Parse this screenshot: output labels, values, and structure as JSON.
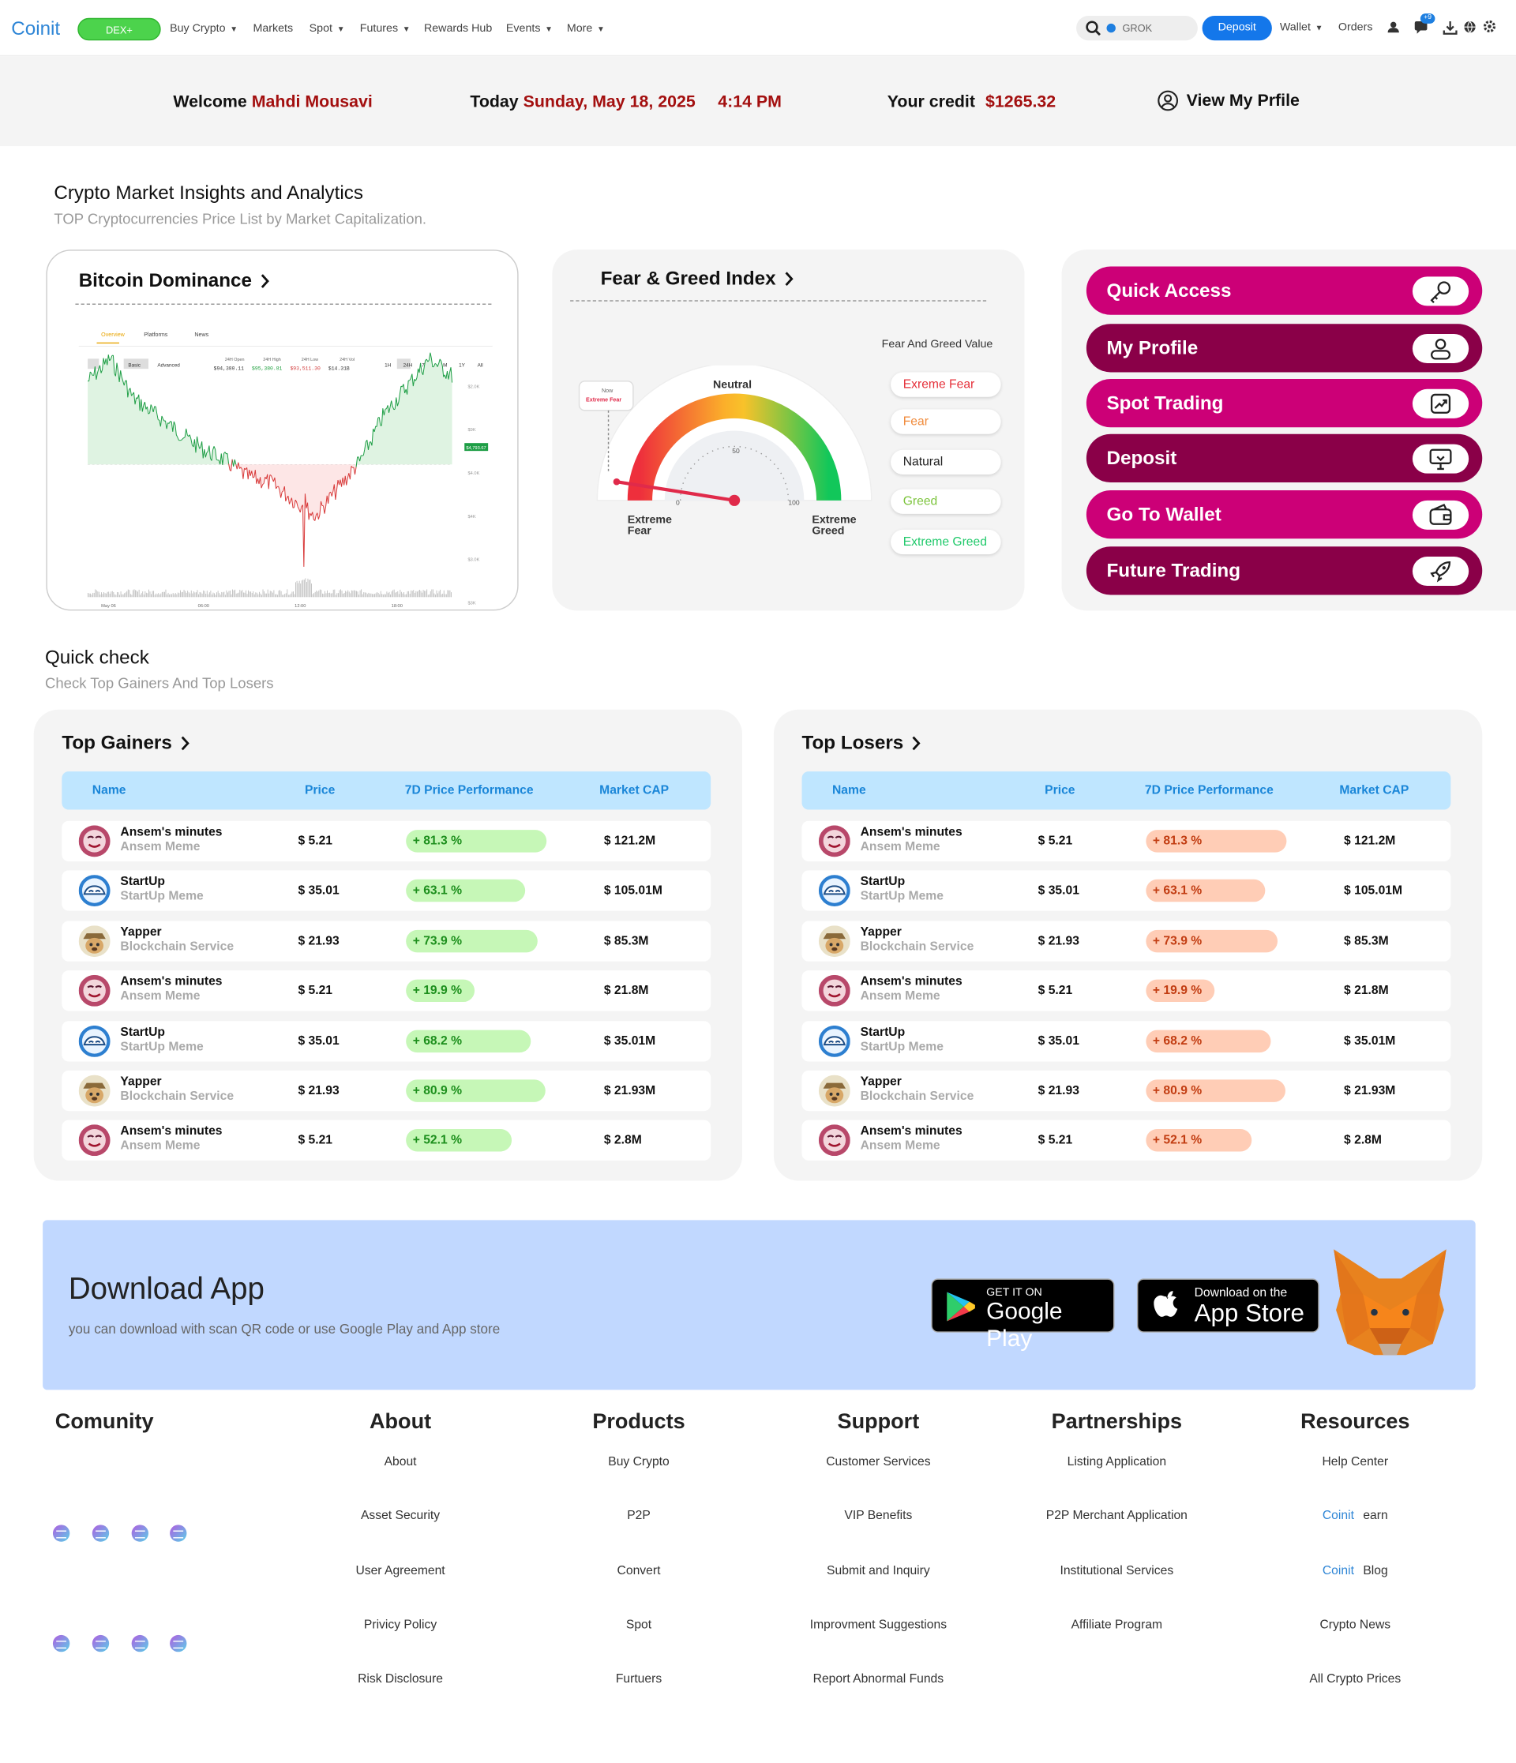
{
  "nav": {
    "logo": "Coinit",
    "dex": "DEX+",
    "items": [
      {
        "label": "Buy Crypto",
        "caret": true
      },
      {
        "label": "Markets",
        "caret": false
      },
      {
        "label": "Spot",
        "caret": true
      },
      {
        "label": "Futures",
        "caret": true
      },
      {
        "label": "Rewards Hub",
        "caret": false
      },
      {
        "label": "Events",
        "caret": true
      },
      {
        "label": "More",
        "caret": true
      }
    ],
    "search_text": "GROK",
    "deposit": "Deposit",
    "wallet": "Wallet",
    "orders": "Orders",
    "notif_badge": "+9"
  },
  "welcome": {
    "label": "Welcome",
    "name": "Mahdi Mousavi",
    "today_label": "Today",
    "date": "Sunday, May 18, 2025",
    "time": "4:14 PM",
    "credit_label": "Your credit",
    "credit": "$1265.32",
    "profile": "View My Prfile"
  },
  "insights": {
    "title": "Crypto Market Insights and Analytics",
    "subtitle": "TOP Cryptocurrencies Price List by Market Capitalization."
  },
  "btc": {
    "title": "Bitcoin Dominance",
    "tabs": [
      "Overview",
      "Platforms",
      "News"
    ],
    "modes": [
      "Basic",
      "Advanced"
    ],
    "stats": [
      {
        "label": "24H Open",
        "value": "$94,380.11",
        "color": "#333"
      },
      {
        "label": "24H High",
        "value": "$95,380.81",
        "color": "#1a9e3a"
      },
      {
        "label": "24H Low",
        "value": "$93,511.30",
        "color": "#d23a3a"
      },
      {
        "label": "24H Vol",
        "value": "$14.31B",
        "color": "#333"
      }
    ],
    "ranges": [
      "1H",
      "24H",
      "7D",
      "1M",
      "1Y",
      "All"
    ],
    "price_tag": "$4,793.67",
    "yticks": [
      "$2.0K",
      "$9K",
      "$4.0K",
      "$4K",
      "$3.0K",
      "$3K"
    ],
    "xticks": [
      "May 06",
      "06:00",
      "12:00",
      "18:00"
    ]
  },
  "fear": {
    "title": "Fear & Greed Index",
    "legend_title": "Fear And Greed Value",
    "now_label": "Now",
    "now_value": "Extreme Fear",
    "neutral": "Neutral",
    "left_label": "Extreme Fear",
    "right_label": "Extreme Greed",
    "ticks": [
      "0",
      "50",
      "100"
    ],
    "value": 5,
    "levels": [
      {
        "label": "Exreme Fear",
        "color": "#e5303a"
      },
      {
        "label": "Fear",
        "color": "#f08a3a"
      },
      {
        "label": "Natural",
        "color": "#222222"
      },
      {
        "label": "Greed",
        "color": "#7cc43c"
      },
      {
        "label": "Extreme Greed",
        "color": "#1fc96a"
      }
    ]
  },
  "quick_access": [
    {
      "label": "Quick Access",
      "icon": "key-icon",
      "color": "#cc0077"
    },
    {
      "label": "My Profile",
      "icon": "user-icon",
      "color": "#8a0048"
    },
    {
      "label": "Spot Trading",
      "icon": "chart-up-icon",
      "color": "#cc0077"
    },
    {
      "label": "Deposit",
      "icon": "deposit-icon",
      "color": "#8a0048"
    },
    {
      "label": "Go To Wallet",
      "icon": "wallet-icon",
      "color": "#cc0077"
    },
    {
      "label": "Future Trading",
      "icon": "rocket-icon",
      "color": "#8a0048"
    }
  ],
  "quick_check": {
    "title": "Quick check",
    "subtitle": "Check Top Gainers And Top Losers"
  },
  "columns": [
    "Name",
    "Price",
    "7D Price Performance",
    "Market CAP"
  ],
  "gainers": {
    "title": "Top Gainers",
    "rows": [
      {
        "name": "Ansem's minutes",
        "sub": "Ansem Meme",
        "avatar": "mask",
        "price": "$ 5.21",
        "perf": "+ 81.3 %",
        "pct": 81.3,
        "cap": "$ 121.2M"
      },
      {
        "name": "StartUp",
        "sub": "StartUp Meme",
        "avatar": "cloud",
        "price": "$ 35.01",
        "perf": "+ 63.1 %",
        "pct": 63.1,
        "cap": "$ 105.01M"
      },
      {
        "name": "Yapper",
        "sub": "Blockchain Service",
        "avatar": "dog",
        "price": "$ 21.93",
        "perf": "+ 73.9 %",
        "pct": 73.9,
        "cap": "$ 85.3M"
      },
      {
        "name": "Ansem's minutes",
        "sub": "Ansem Meme",
        "avatar": "mask",
        "price": "$ 5.21",
        "perf": "+ 19.9 %",
        "pct": 19.9,
        "cap": "$ 21.8M"
      },
      {
        "name": "StartUp",
        "sub": "StartUp Meme",
        "avatar": "cloud",
        "price": "$ 35.01",
        "perf": "+ 68.2 %",
        "pct": 68.2,
        "cap": "$ 35.01M"
      },
      {
        "name": "Yapper",
        "sub": "Blockchain Service",
        "avatar": "dog",
        "price": "$ 21.93",
        "perf": "+ 80.9 %",
        "pct": 80.9,
        "cap": "$ 21.93M"
      },
      {
        "name": "Ansem's minutes",
        "sub": "Ansem Meme",
        "avatar": "mask",
        "price": "$ 5.21",
        "perf": "+ 52.1 %",
        "pct": 52.1,
        "cap": "$ 2.8M"
      }
    ]
  },
  "losers": {
    "title": "Top Losers",
    "rows": [
      {
        "name": "Ansem's minutes",
        "sub": "Ansem Meme",
        "avatar": "mask",
        "price": "$ 5.21",
        "perf": "+ 81.3 %",
        "pct": 81.3,
        "cap": "$ 121.2M"
      },
      {
        "name": "StartUp",
        "sub": "StartUp Meme",
        "avatar": "cloud",
        "price": "$ 35.01",
        "perf": "+ 63.1 %",
        "pct": 63.1,
        "cap": "$ 105.01M"
      },
      {
        "name": "Yapper",
        "sub": "Blockchain Service",
        "avatar": "dog",
        "price": "$ 21.93",
        "perf": "+ 73.9 %",
        "pct": 73.9,
        "cap": "$ 85.3M"
      },
      {
        "name": "Ansem's minutes",
        "sub": "Ansem Meme",
        "avatar": "mask",
        "price": "$ 5.21",
        "perf": "+ 19.9 %",
        "pct": 19.9,
        "cap": "$ 21.8M"
      },
      {
        "name": "StartUp",
        "sub": "StartUp Meme",
        "avatar": "cloud",
        "price": "$ 35.01",
        "perf": "+ 68.2 %",
        "pct": 68.2,
        "cap": "$ 35.01M"
      },
      {
        "name": "Yapper",
        "sub": "Blockchain Service",
        "avatar": "dog",
        "price": "$ 21.93",
        "perf": "+ 80.9 %",
        "pct": 80.9,
        "cap": "$ 21.93M"
      },
      {
        "name": "Ansem's minutes",
        "sub": "Ansem Meme",
        "avatar": "mask",
        "price": "$ 5.21",
        "perf": "+ 52.1 %",
        "pct": 52.1,
        "cap": "$ 2.8M"
      }
    ]
  },
  "download": {
    "title": "Download App",
    "subtitle": "you can download with scan QR code or use Google Play and App store",
    "gp_small": "GET IT ON",
    "gp_big": "Google Play",
    "as_small": "Download on the",
    "as_big": "App Store"
  },
  "footer": {
    "columns": [
      {
        "title": "Comunity",
        "links": []
      },
      {
        "title": "About",
        "links": [
          "About",
          "Asset Security",
          "User Agreement",
          "Privicy Policy",
          "Risk Disclosure"
        ]
      },
      {
        "title": "Products",
        "links": [
          "Buy Crypto",
          "P2P",
          "Convert",
          "Spot",
          "Furtuers"
        ]
      },
      {
        "title": "Support",
        "links": [
          "Customer Services",
          "VIP Benefits",
          "Submit and Inquiry",
          "Improvment Suggestions",
          "Report Abnormal Funds"
        ]
      },
      {
        "title": "Partnerships",
        "links": [
          "Listing Application",
          "P2P Merchant Application",
          "Institutional Services",
          "Affiliate Program"
        ]
      },
      {
        "title": "Resources",
        "links": [
          "Help Center",
          "Coinit earn",
          "Coinit Blog",
          "Crypto News",
          "All Crypto Prices"
        ]
      }
    ],
    "brand": "Coinit",
    "community_icons": 8
  }
}
